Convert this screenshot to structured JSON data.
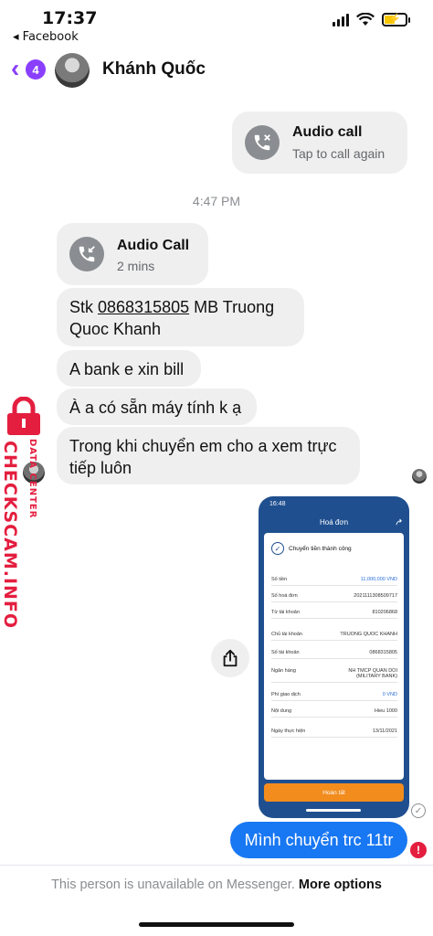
{
  "status_bar": {
    "time": "17:37",
    "back_app_label": "◂ Facebook"
  },
  "header": {
    "unread_count": "4",
    "contact_name": "Khánh Quốc"
  },
  "messages": {
    "outgoing_call": {
      "title": "Audio call",
      "subtitle": "Tap to call again"
    },
    "timestamp": "4:47 PM",
    "incoming_call": {
      "title": "Audio Call",
      "subtitle": "2 mins"
    },
    "stk_prefix": "Stk ",
    "stk_number": "0868315805",
    "stk_suffix": " MB Truong",
    "stk_line2": "Quoc Khanh",
    "msg_bank": "A bank e xin bill",
    "msg_laptop": "À a có sẵn máy tính k ạ",
    "msg_transfer_line1": "Trong khi chuyển em cho a xem trực",
    "msg_transfer_line2": "tiếp luôn",
    "outgoing_text": "Mình chuyển trc 11tr"
  },
  "receipt": {
    "status_time": "16:48",
    "title": "Hoá đơn",
    "success": "Chuyển tiền thành công",
    "rows": [
      {
        "label": "Số tiền",
        "value": "11,000,000 VND"
      },
      {
        "label": "Số hoá đơn",
        "value": "2021111308509717"
      },
      {
        "label": "Từ tài khoản",
        "value": "810206868"
      },
      {
        "label": "Chủ tài khoản",
        "value": "TRUONG QUOC KHANH"
      },
      {
        "label": "Số tài khoản",
        "value": "0868315805"
      },
      {
        "label": "Ngân hàng",
        "value": "NH TMCP QUAN DOI (MILITARY BANK)"
      },
      {
        "label": "Phí giao dịch",
        "value": "0 VND"
      },
      {
        "label": "Nội dung",
        "value": "Hieu 1000"
      },
      {
        "label": "Ngày thực hiện",
        "value": "13/11/2021"
      }
    ],
    "done_button": "Hoàn tất"
  },
  "footer": {
    "notice": "This person is unavailable on Messenger.",
    "more_options": "More options"
  },
  "watermark": {
    "main": "CHECKSCAM.INFO",
    "sub": "DATA CENTER"
  },
  "colors": {
    "accent_purple": "#8a3ffc",
    "messenger_blue": "#1877f2",
    "bubble_gray": "#efeff0",
    "error_red": "#e41e3f",
    "receipt_blue": "#1f4f8f",
    "receipt_orange": "#f28c1d"
  }
}
